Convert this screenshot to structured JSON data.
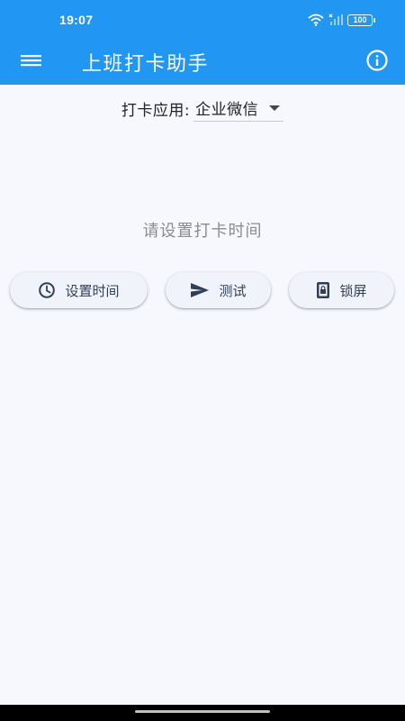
{
  "status_bar": {
    "time": "19:07",
    "battery": "100"
  },
  "app_bar": {
    "title": "上班打卡助手",
    "menu_icon": "menu-icon",
    "info_icon": "info-icon"
  },
  "selector": {
    "label": "打卡应用:",
    "value": "企业微信"
  },
  "hint": "请设置打卡时间",
  "actions": [
    {
      "label": "设置时间",
      "icon": "clock-icon"
    },
    {
      "label": "测试",
      "icon": "send-icon"
    },
    {
      "label": "锁屏",
      "icon": "lock-screen-icon"
    }
  ],
  "colors": {
    "primary": "#2196f3",
    "background": "#f7f8fe",
    "button_text": "#2f3f55",
    "hint": "#8a8c91"
  }
}
